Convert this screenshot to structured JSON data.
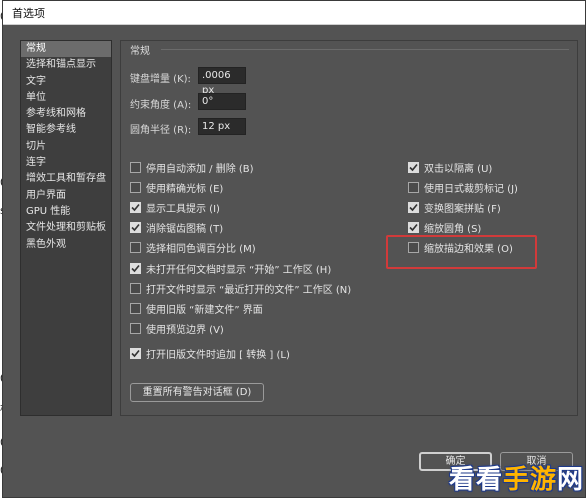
{
  "window": {
    "title": "首选项"
  },
  "sidebar": {
    "items": [
      {
        "label": "常规",
        "selected": true
      },
      {
        "label": "选择和锚点显示"
      },
      {
        "label": "文字"
      },
      {
        "label": "单位"
      },
      {
        "label": "参考线和网格"
      },
      {
        "label": "智能参考线"
      },
      {
        "label": "切片"
      },
      {
        "label": "连字"
      },
      {
        "label": "增效工具和暂存盘"
      },
      {
        "label": "用户界面"
      },
      {
        "label": "GPU 性能"
      },
      {
        "label": "文件处理和剪贴板"
      },
      {
        "label": "黑色外观"
      }
    ]
  },
  "section": {
    "title": "常规"
  },
  "fields": [
    {
      "label": "键盘增量 (K):",
      "value": ".0006 px"
    },
    {
      "label": "约束角度 (A):",
      "value": "0°"
    },
    {
      "label": "圆角半径 (R):",
      "value": "12 px"
    }
  ],
  "left_options": [
    {
      "label": "停用自动添加 / 删除 (B)",
      "checked": false
    },
    {
      "label": "使用精确光标 (E)",
      "checked": false
    },
    {
      "label": "显示工具提示 (I)",
      "checked": true
    },
    {
      "label": "消除锯齿图稿 (T)",
      "checked": true
    },
    {
      "label": "选择相同色调百分比 (M)",
      "checked": false
    },
    {
      "label": "未打开任何文档时显示 “开始” 工作区 (H)",
      "checked": true
    },
    {
      "label": "打开文件时显示 “最近打开的文件” 工作区 (N)",
      "checked": false
    },
    {
      "label": "使用旧版 “新建文件” 界面",
      "checked": false
    },
    {
      "label": "使用预览边界 (V)",
      "checked": false
    },
    {
      "label": "打开旧版文件时追加 [ 转换 ] (L)",
      "checked": true
    }
  ],
  "right_options": [
    {
      "label": "双击以隔离 (U)",
      "checked": true
    },
    {
      "label": "使用日式裁剪标记 (J)",
      "checked": false
    },
    {
      "label": "变换图案拼贴 (F)",
      "checked": true
    },
    {
      "label": "缩放圆角 (S)",
      "checked": true
    },
    {
      "label": "缩放描边和效果 (O)",
      "checked": false
    }
  ],
  "buttons": {
    "reset_warnings": "重置所有警告对话框 (D)",
    "ok": "确定",
    "cancel": "取消"
  },
  "background_fragments": [
    "0",
    "0",
    "s",
    "0",
    "格",
    "0",
    "0"
  ],
  "watermark": {
    "part1": "看看",
    "part2": "手游",
    "part3": "网"
  },
  "colors": {
    "dialog_bg": "#535353",
    "highlight": "#d13a3a"
  }
}
